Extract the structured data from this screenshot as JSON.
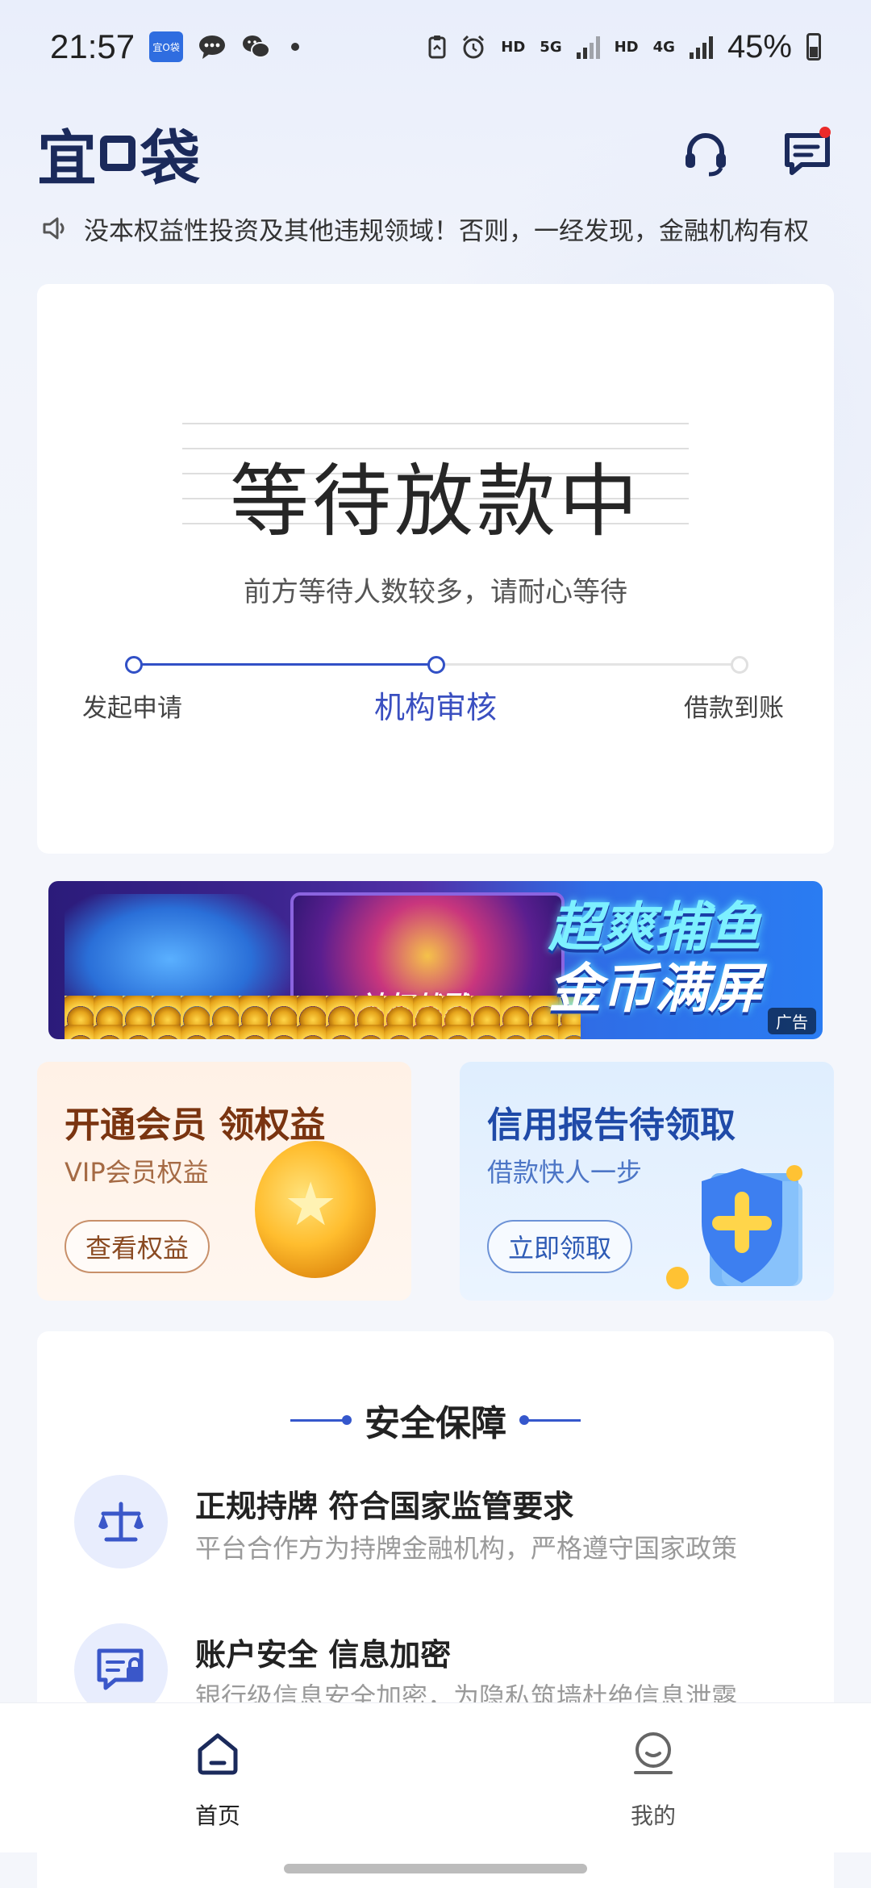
{
  "status_bar": {
    "time": "21:57",
    "network_hd1": "HD",
    "network_5g": "5G",
    "network_hd2": "HD",
    "network_4g": "4G",
    "battery": "45%"
  },
  "header": {
    "logo_text_left": "宜",
    "logo_text_right": "袋",
    "icons": [
      "headset-icon",
      "message-icon"
    ]
  },
  "notice": {
    "text": "没本权益性投资及其他违规领域！否则，一经发现，金融机构有权"
  },
  "loan_status": {
    "title": "等待放款中",
    "subtitle": "前方等待人数较多，请耐心等待",
    "steps": [
      "发起申请",
      "机构审核",
      "借款到账"
    ],
    "current_step": 2
  },
  "ad_banner": {
    "wheel_text": "神权战戮",
    "headline_line1": "超爽捕鱼",
    "headline_line2": "金币满屏",
    "tag": "广告"
  },
  "promos": {
    "vip": {
      "title": "开通会员 领权益",
      "subtitle": "VIP会员权益",
      "button": "查看权益"
    },
    "report": {
      "title": "信用报告待领取",
      "subtitle": "借款快人一步",
      "button": "立即领取"
    }
  },
  "security": {
    "title": "安全保障",
    "items": [
      {
        "icon": "scale-icon",
        "title": "正规持牌 符合国家监管要求",
        "desc": "平台合作方为持牌金融机构，严格遵守国家政策"
      },
      {
        "icon": "id-lock-icon",
        "title": "账户安全 信息加密",
        "desc": "银行级信息安全加密，为隐私筑墙杜绝信息泄露"
      }
    ]
  },
  "bottom_nav": {
    "items": [
      {
        "label": "首页",
        "icon": "home-icon",
        "active": true
      },
      {
        "label": "我的",
        "icon": "profile-icon",
        "active": false
      }
    ]
  },
  "colors": {
    "accent": "#3150c6",
    "brand_dark": "#1b2a5b",
    "notification_dot": "#ea2a2a"
  }
}
